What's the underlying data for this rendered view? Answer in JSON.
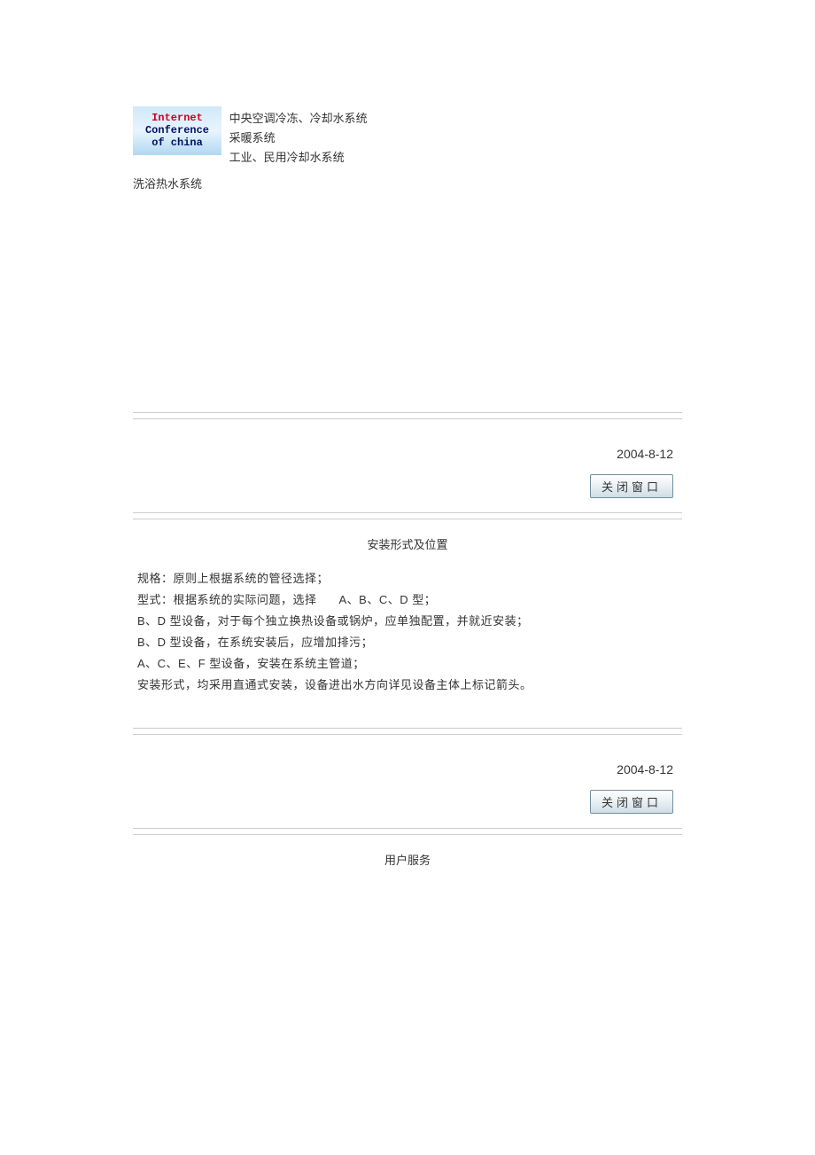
{
  "logo": {
    "line1": "Internet",
    "line2": "Conference",
    "line3": "of china"
  },
  "header": {
    "line1": "中央空调冷冻、冷却水系统",
    "line2": "采暖系统",
    "line3": "工业、民用冷却水系统",
    "below": "洗浴热水系统"
  },
  "section1": {
    "date": "2004-8-12",
    "close_label": "关闭窗口"
  },
  "section2": {
    "title": "安装形式及位置",
    "lines": [
      "规格：原则上根据系统的管径选择；",
      "型式：根据系统的实际问题，选择",
      "A、B、C、D 型；",
      "B、D 型设备，对于每个独立换热设备或锅炉，应单独配置，并就近安装；",
      "B、D 型设备，在系统安装后，应增加排污；",
      "A、C、E、F 型设备，安装在系统主管道；",
      "安装形式，均采用直通式安装，设备进出水方向详见设备主体上标记箭头。"
    ],
    "date": "2004-8-12",
    "close_label": "关闭窗口"
  },
  "section3": {
    "title": "用户服务"
  }
}
